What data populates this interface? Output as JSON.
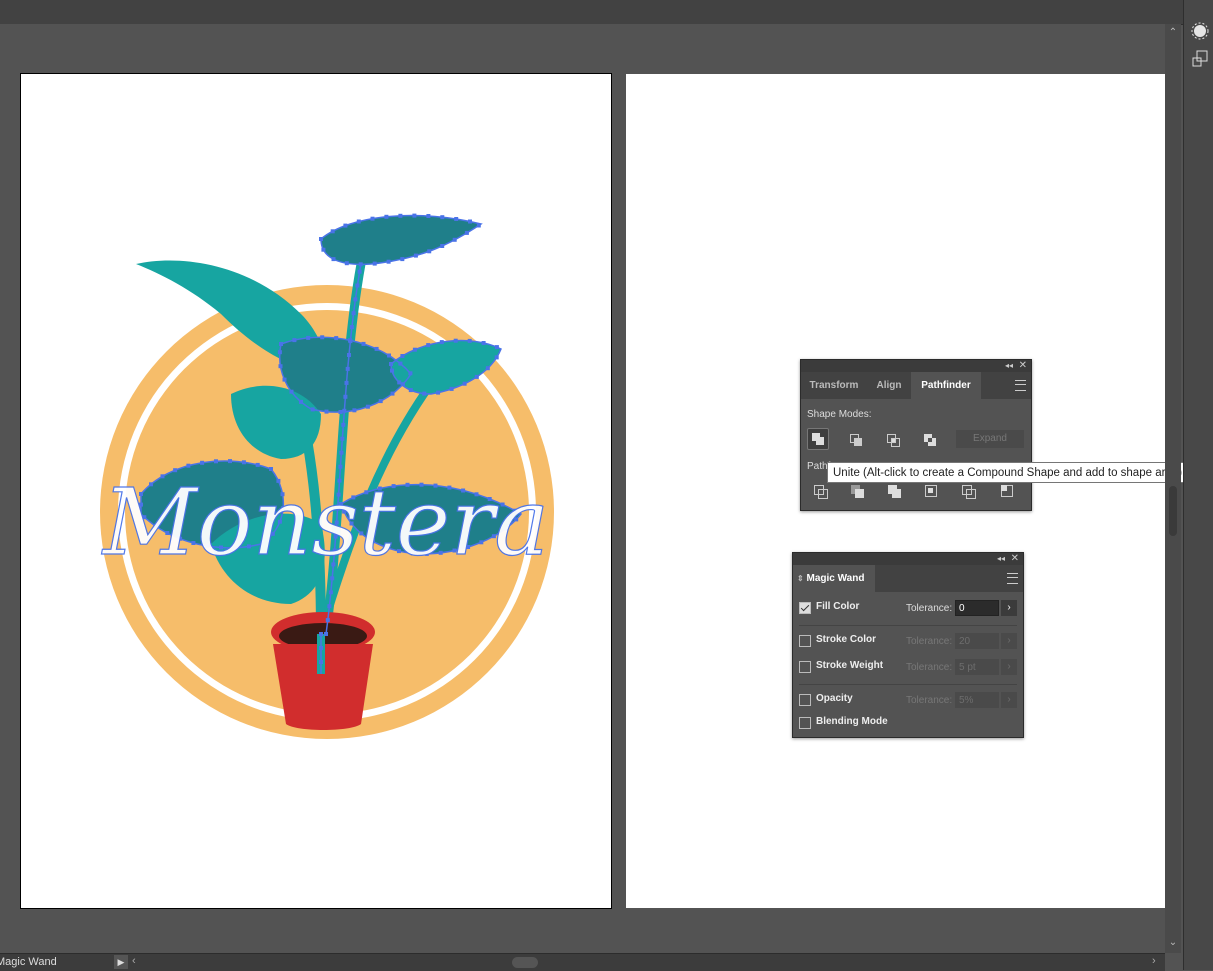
{
  "pathfinder_panel": {
    "tabs": [
      "Transform",
      "Align",
      "Pathfinder"
    ],
    "active_tab": "Pathfinder",
    "shape_modes_label": "Shape Modes:",
    "pathfinders_label": "Pathf",
    "expand_label": "Expand",
    "tooltip": "Unite (Alt-click to create a Compound Shape and add to shape area)",
    "collapse_icon": "◂◂",
    "close_icon": "✕"
  },
  "magic_wand_panel": {
    "title": "Magic Wand",
    "title_arrow": "⇕",
    "fill_color": {
      "label": "Fill Color",
      "checked": true,
      "tolerance_label": "Tolerance:",
      "tolerance": "0"
    },
    "stroke_color": {
      "label": "Stroke Color",
      "checked": false,
      "tolerance_label": "Tolerance:",
      "tolerance": "20"
    },
    "stroke_weight": {
      "label": "Stroke Weight",
      "checked": false,
      "tolerance_label": "Tolerance:",
      "tolerance": "5 pt"
    },
    "opacity": {
      "label": "Opacity",
      "checked": false,
      "tolerance_label": "Tolerance:",
      "tolerance": "5%"
    },
    "blending_mode": {
      "label": "Blending Mode",
      "checked": false
    },
    "collapse_icon": "◂◂",
    "close_icon": "✕"
  },
  "status_bar": {
    "current_tool": "Magic Wand",
    "play_icon": "▶",
    "left_arrow": "‹",
    "right_arrow": "›"
  },
  "artwork": {
    "text": "Monstera",
    "colors": {
      "circle": "#F6BD6A",
      "leaf": "#17A5A1",
      "pot": "#D12D2D",
      "selection": "#4A73E8"
    }
  },
  "scrollbar": {
    "up_arrow": "⌃",
    "down_arrow": "⌄"
  }
}
